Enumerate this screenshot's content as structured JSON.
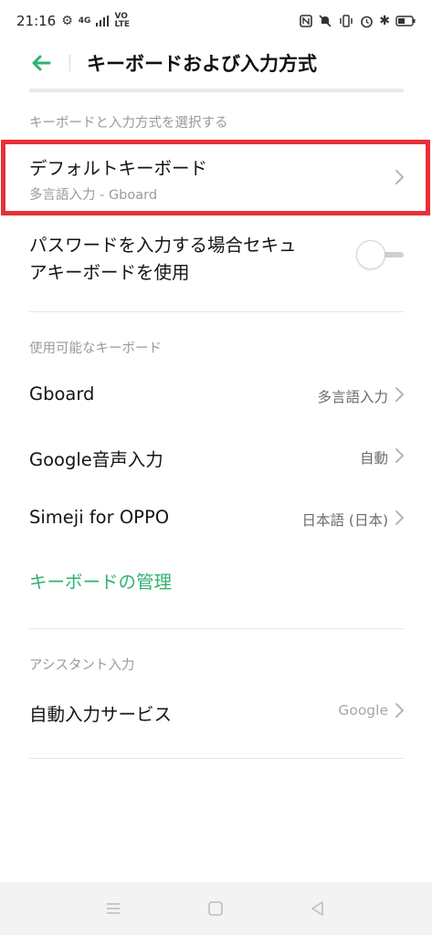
{
  "status_bar": {
    "time": "21:16",
    "network": "4G",
    "volte_top": "VO",
    "volte_bottom": "LTE"
  },
  "header": {
    "title": "キーボードおよび入力方式"
  },
  "section_select": {
    "label": "キーボードと入力方式を選択する"
  },
  "default_keyboard": {
    "title": "デフォルトキーボード",
    "subtitle": "多言語入力 - Gboard"
  },
  "secure_keyboard": {
    "line1": "パスワードを入力する場合セキュ",
    "line2": "アキーボードを使用",
    "enabled": false
  },
  "section_available": {
    "label": "使用可能なキーボード"
  },
  "keyboards": [
    {
      "name": "Gboard",
      "value": "多言語入力"
    },
    {
      "name": "Google音声入力",
      "value": "自動"
    },
    {
      "name": "Simeji for OPPO",
      "value": "日本語 (日本)"
    }
  ],
  "manage_link": "キーボードの管理",
  "section_assistant": {
    "label": "アシスタント入力"
  },
  "autofill": {
    "title": "自動入力サービス",
    "value": "Google"
  },
  "colors": {
    "accent": "#2fb36f",
    "highlight": "#e63137"
  }
}
